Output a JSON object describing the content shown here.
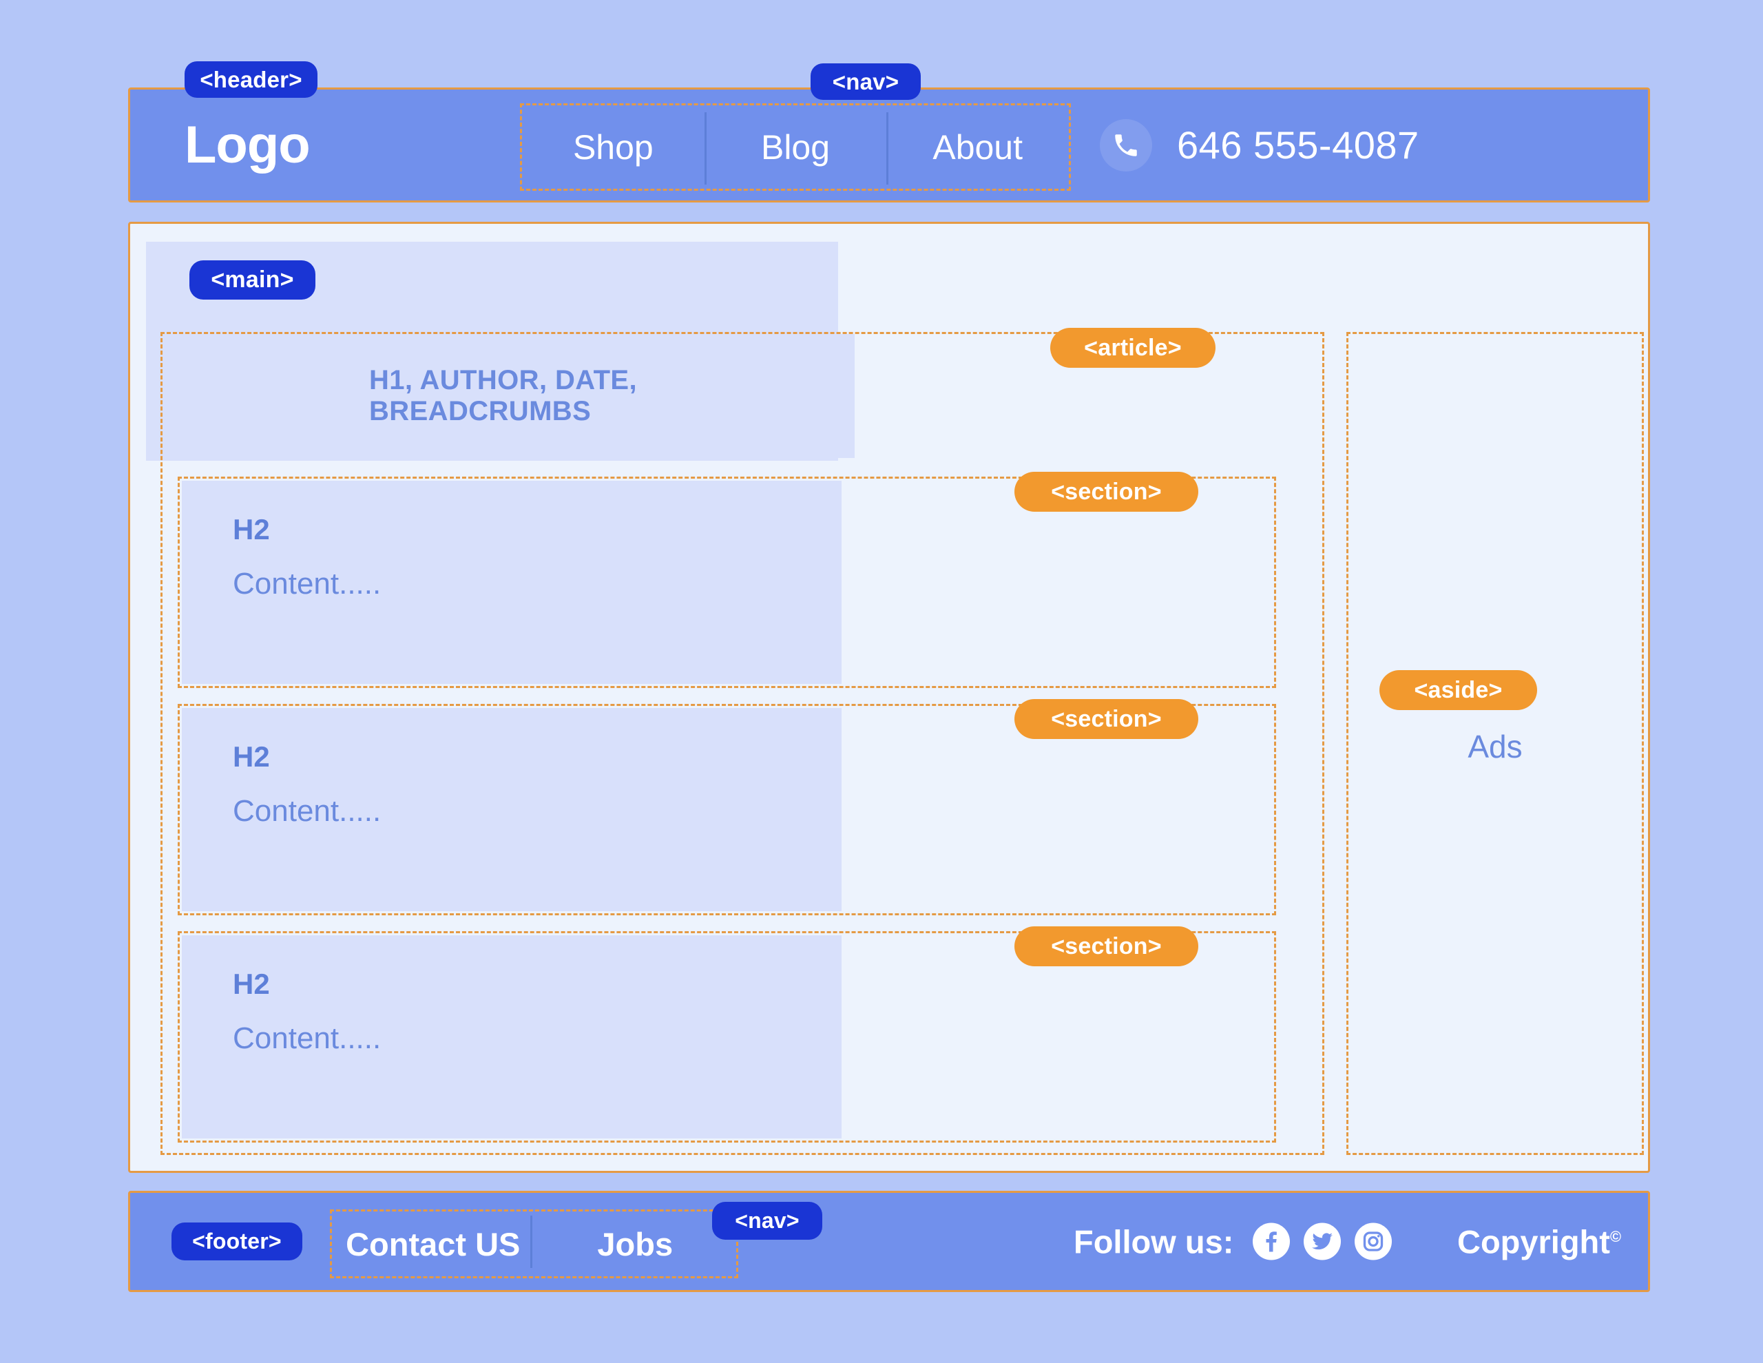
{
  "colors": {
    "page_bg": "#b4c6f8",
    "bar_blue": "#7190ec",
    "badge_blue": "#1a35d4",
    "badge_orange": "#f2992e",
    "border_orange": "#e59a44",
    "main_bg": "#edf3fd",
    "block_fill": "#d8e0fb",
    "text_blue": "#6a8ade"
  },
  "header": {
    "tag": "<header>",
    "logo": "Logo",
    "nav": {
      "tag": "<nav>",
      "items": [
        {
          "label": "Shop"
        },
        {
          "label": "Blog"
        },
        {
          "label": "About"
        }
      ]
    },
    "phone": {
      "icon": "phone-icon",
      "number": "646 555-4087"
    }
  },
  "main": {
    "tag": "<main>",
    "article": {
      "tag": "<article>",
      "headline": "H1, AUTHOR, DATE, BREADCRUMBS",
      "sections": [
        {
          "tag": "<section>",
          "heading": "H2",
          "content": "Content....."
        },
        {
          "tag": "<section>",
          "heading": "H2",
          "content": "Content....."
        },
        {
          "tag": "<section>",
          "heading": "H2",
          "content": "Content....."
        }
      ]
    },
    "aside": {
      "tag": "<aside>",
      "label": "Ads"
    }
  },
  "footer": {
    "tag": "<footer>",
    "nav": {
      "tag": "<nav>",
      "items": [
        {
          "label": "Contact US"
        },
        {
          "label": "Jobs"
        }
      ]
    },
    "follow": {
      "label": "Follow us:",
      "socials": [
        {
          "icon": "facebook-icon"
        },
        {
          "icon": "twitter-icon"
        },
        {
          "icon": "instagram-icon"
        }
      ]
    },
    "copyright": {
      "text": "Copyright",
      "mark": "©"
    }
  }
}
